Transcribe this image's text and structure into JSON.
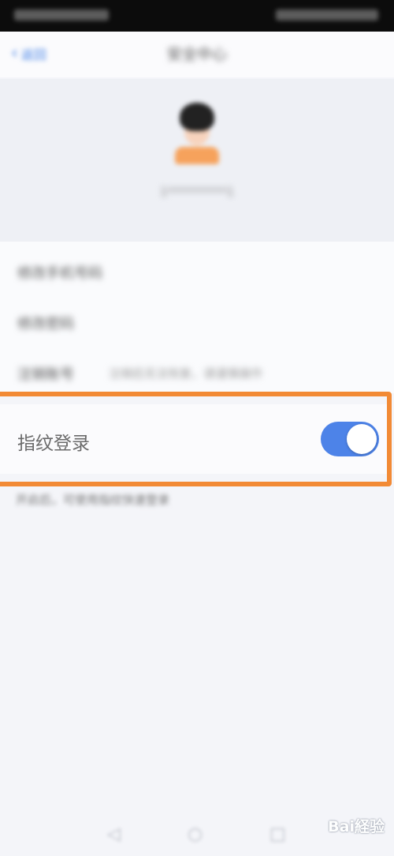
{
  "nav": {
    "back_label": "返回",
    "title": "安全中心"
  },
  "profile": {
    "name": "1**********1"
  },
  "menu": {
    "items": [
      {
        "label": "修改手机号码",
        "sub": ""
      },
      {
        "label": "修改密码",
        "sub": ""
      },
      {
        "label": "注销账号",
        "sub": "注销后无法恢复，请谨慎操作"
      }
    ]
  },
  "fingerprint": {
    "label": "指纹登录",
    "enabled": true
  },
  "hint": "开启后，可使用指纹快速登录",
  "colors": {
    "accent": "#4d83e8",
    "highlight": "#f28a35",
    "background": "#f4f5f9"
  },
  "icons": {
    "back": "chevron-left-icon",
    "bottom_back": "triangle-left-icon",
    "bottom_home": "circle-icon",
    "bottom_recent": "square-icon"
  },
  "watermark": "Bai経验"
}
